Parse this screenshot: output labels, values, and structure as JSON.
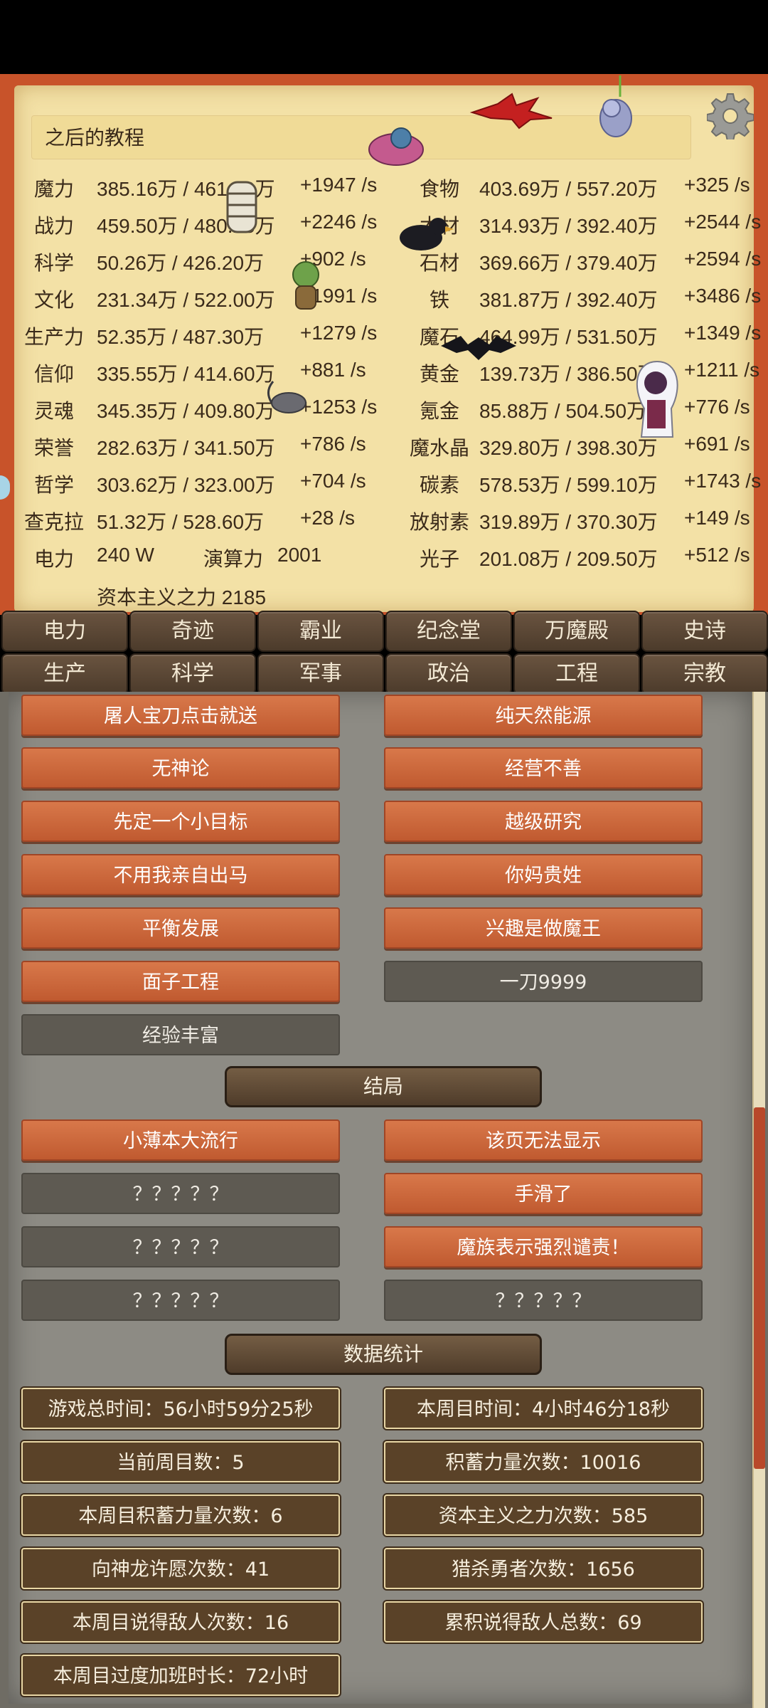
{
  "tutorial_text": "之后的教程",
  "resources": [
    {
      "name1": "魔力",
      "val1": "385.16万 / 461.50万",
      "rate1": "+1947 /s",
      "name2": "食物",
      "val2": "403.69万 / 557.20万",
      "rate2": "+325 /s"
    },
    {
      "name1": "战力",
      "val1": "459.50万 / 480.25万",
      "rate1": "+2246 /s",
      "name2": "木材",
      "val2": "314.93万 / 392.40万",
      "rate2": "+2544 /s"
    },
    {
      "name1": "科学",
      "val1": "50.26万 / 426.20万",
      "rate1": "+902 /s",
      "name2": "石材",
      "val2": "369.66万 / 379.40万",
      "rate2": "+2594 /s"
    },
    {
      "name1": "文化",
      "val1": "231.34万 / 522.00万",
      "rate1": "+1991 /s",
      "name2": "铁",
      "val2": "381.87万 / 392.40万",
      "rate2": "+3486 /s"
    },
    {
      "name1": "生产力",
      "val1": "52.35万 / 487.30万",
      "rate1": "+1279 /s",
      "name2": "魔石",
      "val2": "464.99万 / 531.50万",
      "rate2": "+1349 /s"
    },
    {
      "name1": "信仰",
      "val1": "335.55万 / 414.60万",
      "rate1": "+881 /s",
      "name2": "黄金",
      "val2": "139.73万 / 386.50万",
      "rate2": "+1211 /s"
    },
    {
      "name1": "灵魂",
      "val1": "345.35万 / 409.80万",
      "rate1": "+1253 /s",
      "name2": "氪金",
      "val2": "85.88万 / 504.50万",
      "rate2": "+776 /s"
    },
    {
      "name1": "荣誉",
      "val1": "282.63万 / 341.50万",
      "rate1": "+786 /s",
      "name2": "魔水晶",
      "val2": "329.80万 / 398.30万",
      "rate2": "+691 /s"
    },
    {
      "name1": "哲学",
      "val1": "303.62万 / 323.00万",
      "rate1": "+704 /s",
      "name2": "碳素",
      "val2": "578.53万 / 599.10万",
      "rate2": "+1743 /s"
    },
    {
      "name1": "查克拉",
      "val1": "51.32万 / 528.60万",
      "rate1": "+28 /s",
      "name2": "放射素",
      "val2": "319.89万 / 370.30万",
      "rate2": "+149 /s"
    }
  ],
  "power_row": {
    "label": "电力",
    "value": "240 W",
    "compute_label": "演算力",
    "compute_value": "2001",
    "name2": "光子",
    "val2": "201.08万 / 209.50万",
    "rate2": "+512 /s"
  },
  "capitalism": "资本主义之力 2185",
  "tabs_row1": [
    "电力",
    "奇迹",
    "霸业",
    "纪念堂",
    "万魔殿",
    "史诗"
  ],
  "tabs_row2": [
    "生产",
    "科学",
    "军事",
    "政治",
    "工程",
    "宗教"
  ],
  "achievements": [
    [
      "屠人宝刀点击就送",
      "纯天然能源"
    ],
    [
      "无神论",
      "经营不善"
    ],
    [
      "先定一个小目标",
      "越级研究"
    ],
    [
      "不用我亲自出马",
      "你妈贵姓"
    ],
    [
      "平衡发展",
      "兴趣是做魔王"
    ],
    [
      "面子工程",
      "一刀9999"
    ],
    [
      "经验丰富"
    ]
  ],
  "endings_title": "结局",
  "endings": [
    [
      "小薄本大流行",
      "该页无法显示"
    ],
    [
      "？？？？？",
      "手滑了"
    ],
    [
      "？？？？？",
      "魔族表示强烈谴责！"
    ],
    [
      "？？？？？",
      "？？？？？"
    ]
  ],
  "stats_title": "数据统计",
  "stats": [
    [
      "游戏总时间：56小时59分25秒",
      "本周目时间：4小时46分18秒"
    ],
    [
      "当前周目数：5",
      "积蓄力量次数：10016"
    ],
    [
      "本周目积蓄力量次数：6",
      "资本主义之力次数：585"
    ],
    [
      "向神龙许愿次数：41",
      "猎杀勇者次数：1656"
    ],
    [
      "本周目说得敌人次数：16",
      "累积说得敌人总数：69"
    ],
    [
      "本周目过度加班时长：72小时"
    ]
  ],
  "colors": {
    "frame": "#c8532a",
    "parchment": "#f3e1a6",
    "button_on": "#c96538",
    "button_off": "#5e5a52",
    "stat_bg": "#5a4228"
  }
}
